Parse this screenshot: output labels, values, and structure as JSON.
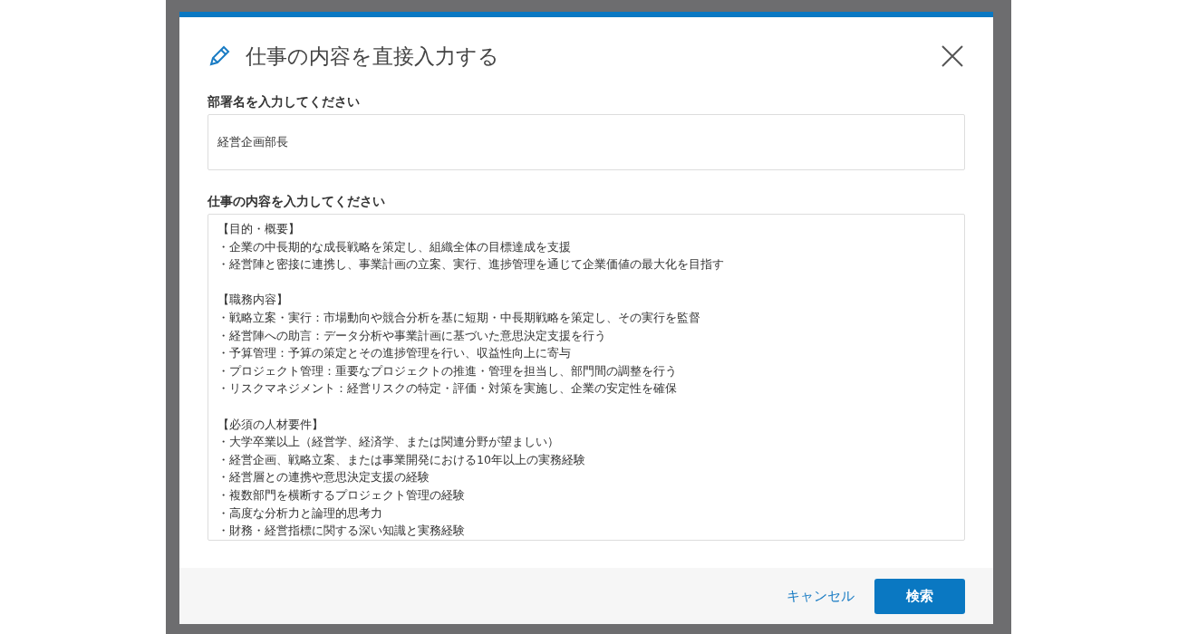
{
  "dialog": {
    "title": "仕事の内容を直接入力する",
    "fields": [
      {
        "kind": "input",
        "label": "部署名を入力してください",
        "value": "経営企画部長"
      },
      {
        "kind": "textarea",
        "label": "仕事の内容を入力してください",
        "sections": [
          {
            "heading": "【目的・概要】",
            "lines": [
              "・企業の中長期的な成長戦略を策定し、組織全体の目標達成を支援",
              "・経営陣と密接に連携し、事業計画の立案、実行、進捗管理を通じて企業価値の最大化を目指す"
            ]
          },
          {
            "heading": "【職務内容】",
            "lines": [
              "・戦略立案・実行：市場動向や競合分析を基に短期・中長期戦略を策定し、その実行を監督",
              "・経営陣への助言：データ分析や事業計画に基づいた意思決定支援を行う",
              "・予算管理：予算の策定とその進捗管理を行い、収益性向上に寄与",
              "・プロジェクト管理：重要なプロジェクトの推進・管理を担当し、部門間の調整を行う",
              "・リスクマネジメント：経営リスクの特定・評価・対策を実施し、企業の安定性を確保"
            ]
          },
          {
            "heading": "【必須の人材要件】",
            "lines": [
              "・大学卒業以上（経営学、経済学、または関連分野が望ましい）",
              "・経営企画、戦略立案、または事業開発における10年以上の実務経験",
              "・経営層との連携や意思決定支援の経験",
              "・複数部門を横断するプロジェクト管理の経験",
              "・高度な分析力と論理的思考力",
              "・財務・経営指標に関する深い知識と実務経験"
            ]
          }
        ]
      }
    ],
    "buttons": [
      {
        "kind": "link",
        "label": "キャンセル"
      },
      {
        "kind": "primary",
        "label": "検索"
      }
    ]
  }
}
